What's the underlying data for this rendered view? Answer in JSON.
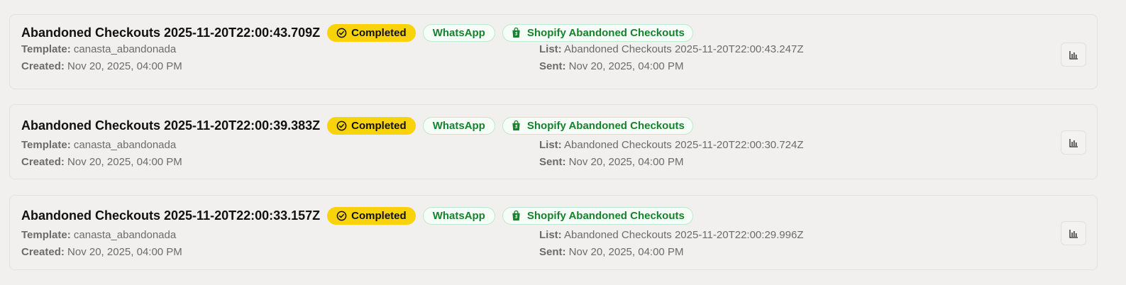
{
  "campaigns": [
    {
      "title": "Abandoned Checkouts 2025-11-20T22:00:43.709Z",
      "status": "Completed",
      "channel": "WhatsApp",
      "source": "Shopify Abandoned Checkouts",
      "template_label": "Template:",
      "template": "canasta_abandonada",
      "created_label": "Created:",
      "created": "Nov 20, 2025, 04:00 PM",
      "list_label": "List:",
      "list": "Abandoned Checkouts 2025-11-20T22:00:43.247Z",
      "sent_label": "Sent:",
      "sent": "Nov 20, 2025, 04:00 PM"
    },
    {
      "title": "Abandoned Checkouts 2025-11-20T22:00:39.383Z",
      "status": "Completed",
      "channel": "WhatsApp",
      "source": "Shopify Abandoned Checkouts",
      "template_label": "Template:",
      "template": "canasta_abandonada",
      "created_label": "Created:",
      "created": "Nov 20, 2025, 04:00 PM",
      "list_label": "List:",
      "list": "Abandoned Checkouts 2025-11-20T22:00:30.724Z",
      "sent_label": "Sent:",
      "sent": "Nov 20, 2025, 04:00 PM"
    },
    {
      "title": "Abandoned Checkouts 2025-11-20T22:00:33.157Z",
      "status": "Completed",
      "channel": "WhatsApp",
      "source": "Shopify Abandoned Checkouts",
      "template_label": "Template:",
      "template": "canasta_abandonada",
      "created_label": "Created:",
      "created": "Nov 20, 2025, 04:00 PM",
      "list_label": "List:",
      "list": "Abandoned Checkouts 2025-11-20T22:00:29.996Z",
      "sent_label": "Sent:",
      "sent": "Nov 20, 2025, 04:00 PM"
    }
  ],
  "icons": {
    "status": "check-circle-icon",
    "source": "shopify-bag-icon",
    "stats": "bar-chart-icon"
  },
  "colors": {
    "status_bg": "#f8d309",
    "channel_text": "#17822d",
    "channel_border": "#bfe9c8"
  }
}
